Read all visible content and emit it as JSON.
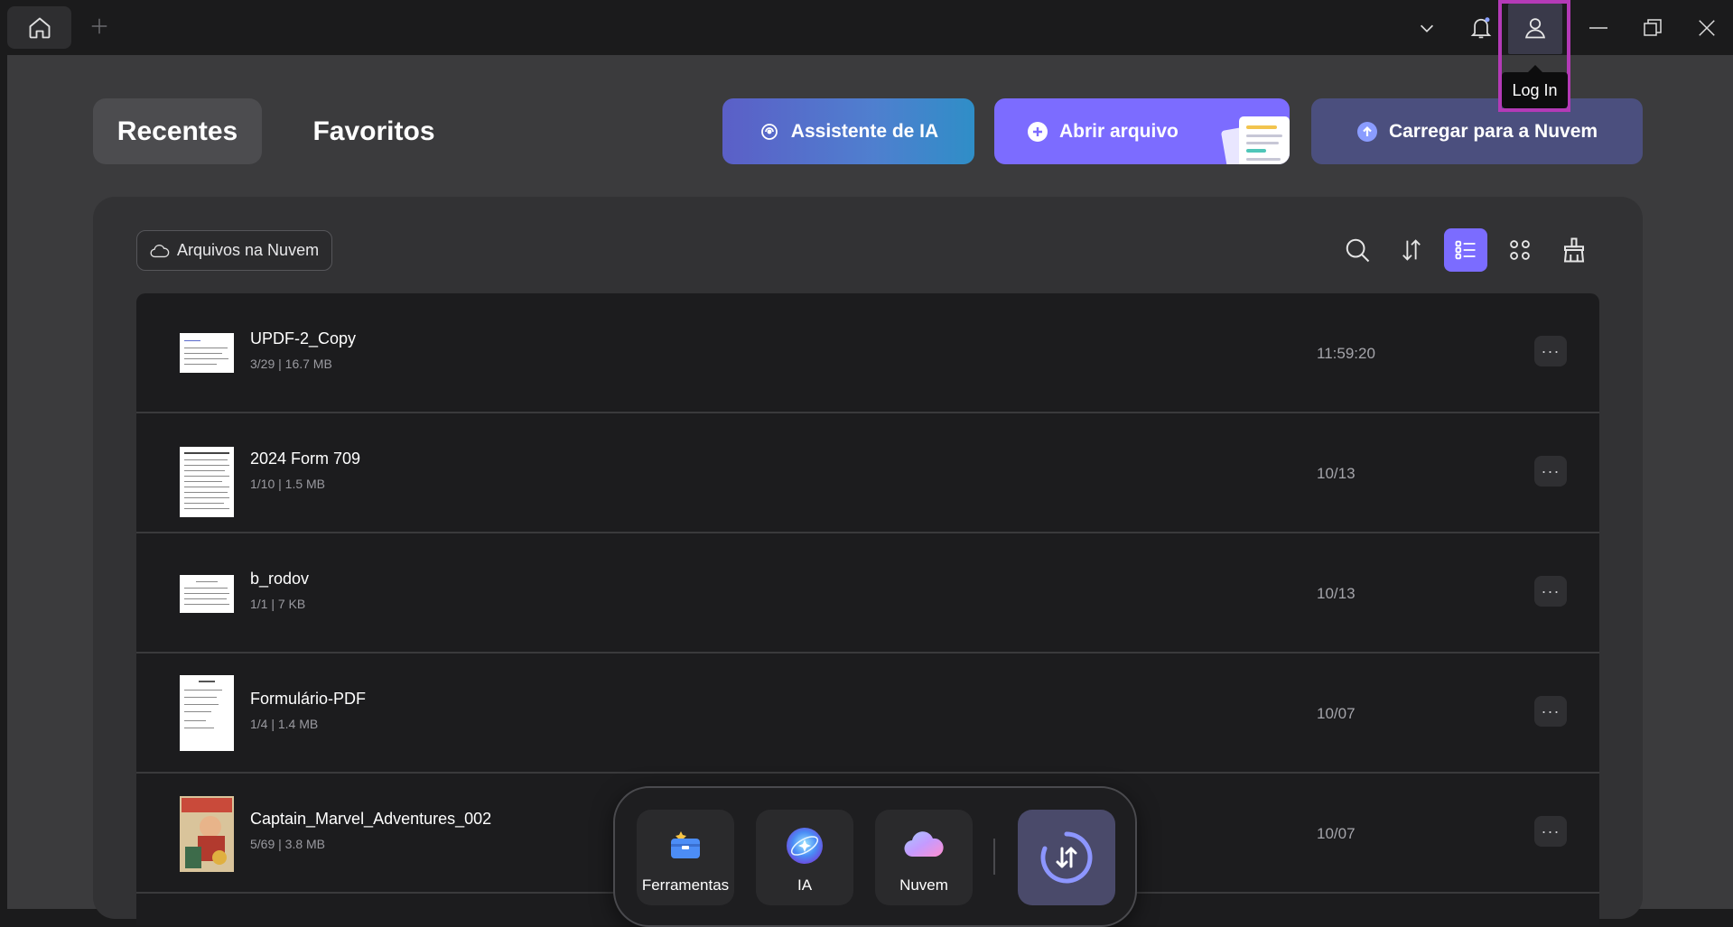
{
  "titlebar": {
    "tooltip_login": "Log In"
  },
  "view_tabs": {
    "recent": "Recentes",
    "favorites": "Favoritos"
  },
  "actions": {
    "ai_assistant": "Assistente de IA",
    "open_file": "Abrir arquivo",
    "upload_cloud": "Carregar para a Nuvem"
  },
  "filter": {
    "cloud_files": "Arquivos na Nuvem"
  },
  "files": [
    {
      "name": "UPDF-2_Copy",
      "meta": "3/29 | 16.7 MB",
      "date": "11:59:20"
    },
    {
      "name": "2024 Form 709",
      "meta": "1/10 | 1.5 MB",
      "date": "10/13"
    },
    {
      "name": "b_rodov",
      "meta": "1/1 | 7 KB",
      "date": "10/13"
    },
    {
      "name": "Formulário-PDF",
      "meta": "1/4 | 1.4 MB",
      "date": "10/07"
    },
    {
      "name": "Captain_Marvel_Adventures_002",
      "meta": "5/69 | 3.8 MB",
      "date": "10/07"
    }
  ],
  "more_label": "···",
  "dock": {
    "tools": "Ferramentas",
    "ai": "IA",
    "cloud": "Nuvem"
  },
  "colors": {
    "accent": "#7b6cff",
    "highlight": "#b43ab7",
    "background": "#3b3b3d"
  }
}
